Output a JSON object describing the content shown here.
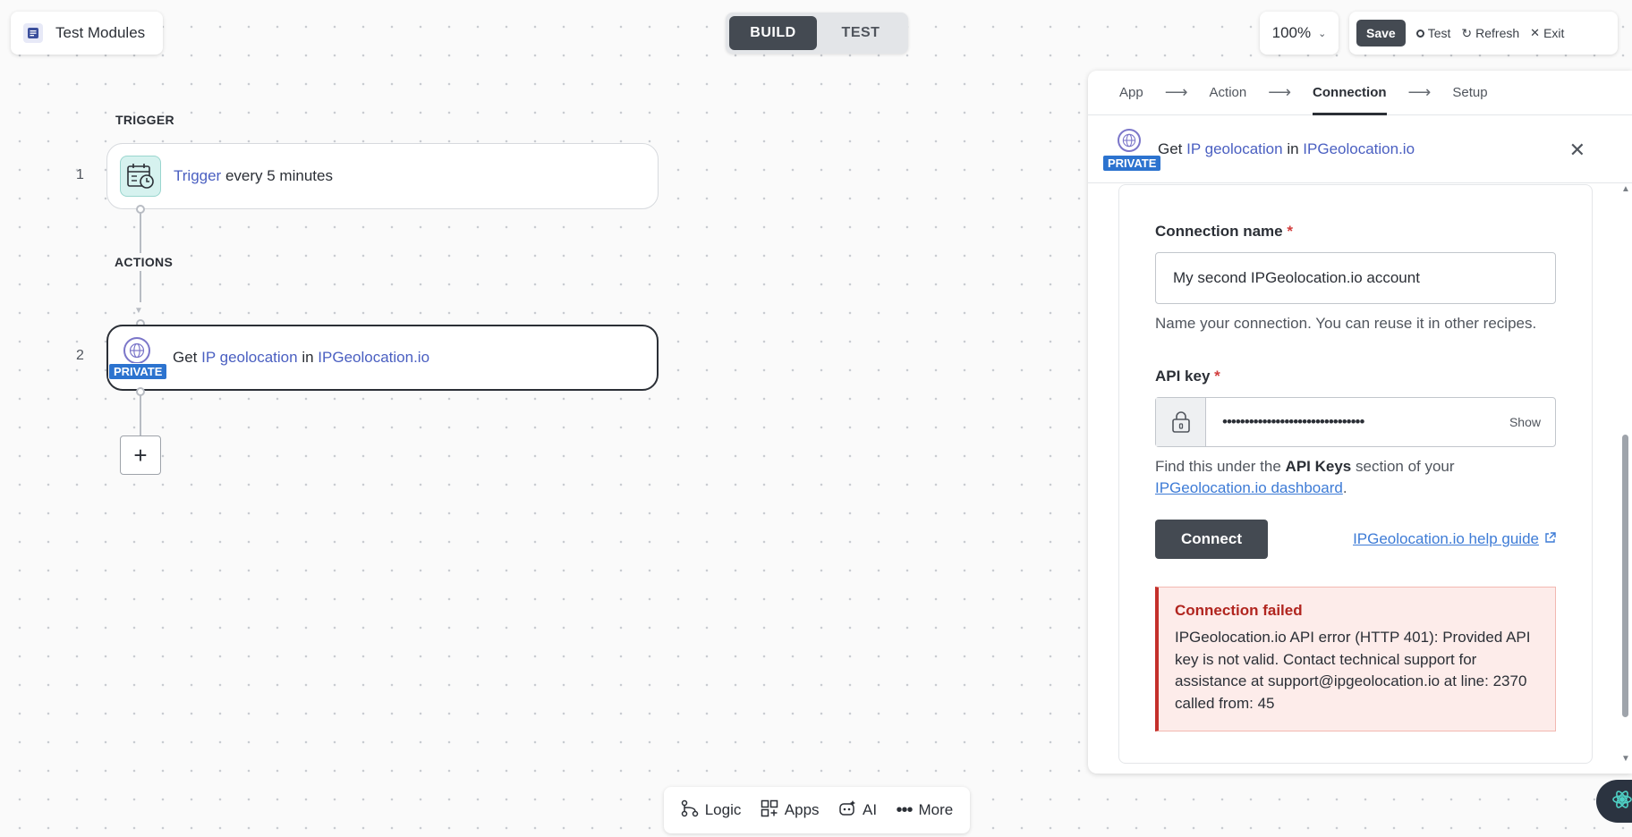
{
  "header": {
    "recipe_name": "Test Modules",
    "mode_build": "BUILD",
    "mode_test": "TEST",
    "zoom": "100%",
    "save": "Save",
    "test": "Test",
    "refresh": "Refresh",
    "exit": "Exit"
  },
  "canvas": {
    "trigger_section": "TRIGGER",
    "actions_section": "ACTIONS",
    "step1": {
      "num": "1",
      "link": "Trigger",
      "text": "every 5 minutes"
    },
    "step2": {
      "num": "2",
      "badge": "PRIVATE",
      "pre": "Get",
      "action": "IP geolocation",
      "mid": "in",
      "app": "IPGeolocation.io"
    },
    "add_step": "+"
  },
  "toolbar": {
    "logic": "Logic",
    "apps": "Apps",
    "ai": "AI",
    "more": "More"
  },
  "panel": {
    "wizard": [
      "App",
      "Action",
      "Connection",
      "Setup"
    ],
    "header": {
      "badge": "PRIVATE",
      "pre": "Get",
      "action": "IP geolocation",
      "mid": "in",
      "app": "IPGeolocation.io"
    },
    "connection_name": {
      "label": "Connection name",
      "required": "*",
      "value": "My second IPGeolocation.io account",
      "hint": "Name your connection. You can reuse it in other recipes."
    },
    "api_key": {
      "label": "API key",
      "required": "*",
      "masked": "••••••••••••••••••••••••••••••••",
      "show": "Show",
      "hint_pre": "Find this under the",
      "hint_bold": "API Keys",
      "hint_post": "section of your",
      "hint_link": "IPGeolocation.io dashboard",
      "hint_end": "."
    },
    "connect": "Connect",
    "help_link": "IPGeolocation.io help guide",
    "error": {
      "title": "Connection failed",
      "message": "IPGeolocation.io API error (HTTP 401): Provided API key is not valid. Contact technical support for assistance at support@ipgeolocation.io at line: 2370 called from: 45"
    }
  },
  "colors": {
    "accent_dark": "#444a52",
    "link": "#3d7bd6",
    "private_badge": "#2c73cf",
    "error": "#c4302b"
  }
}
